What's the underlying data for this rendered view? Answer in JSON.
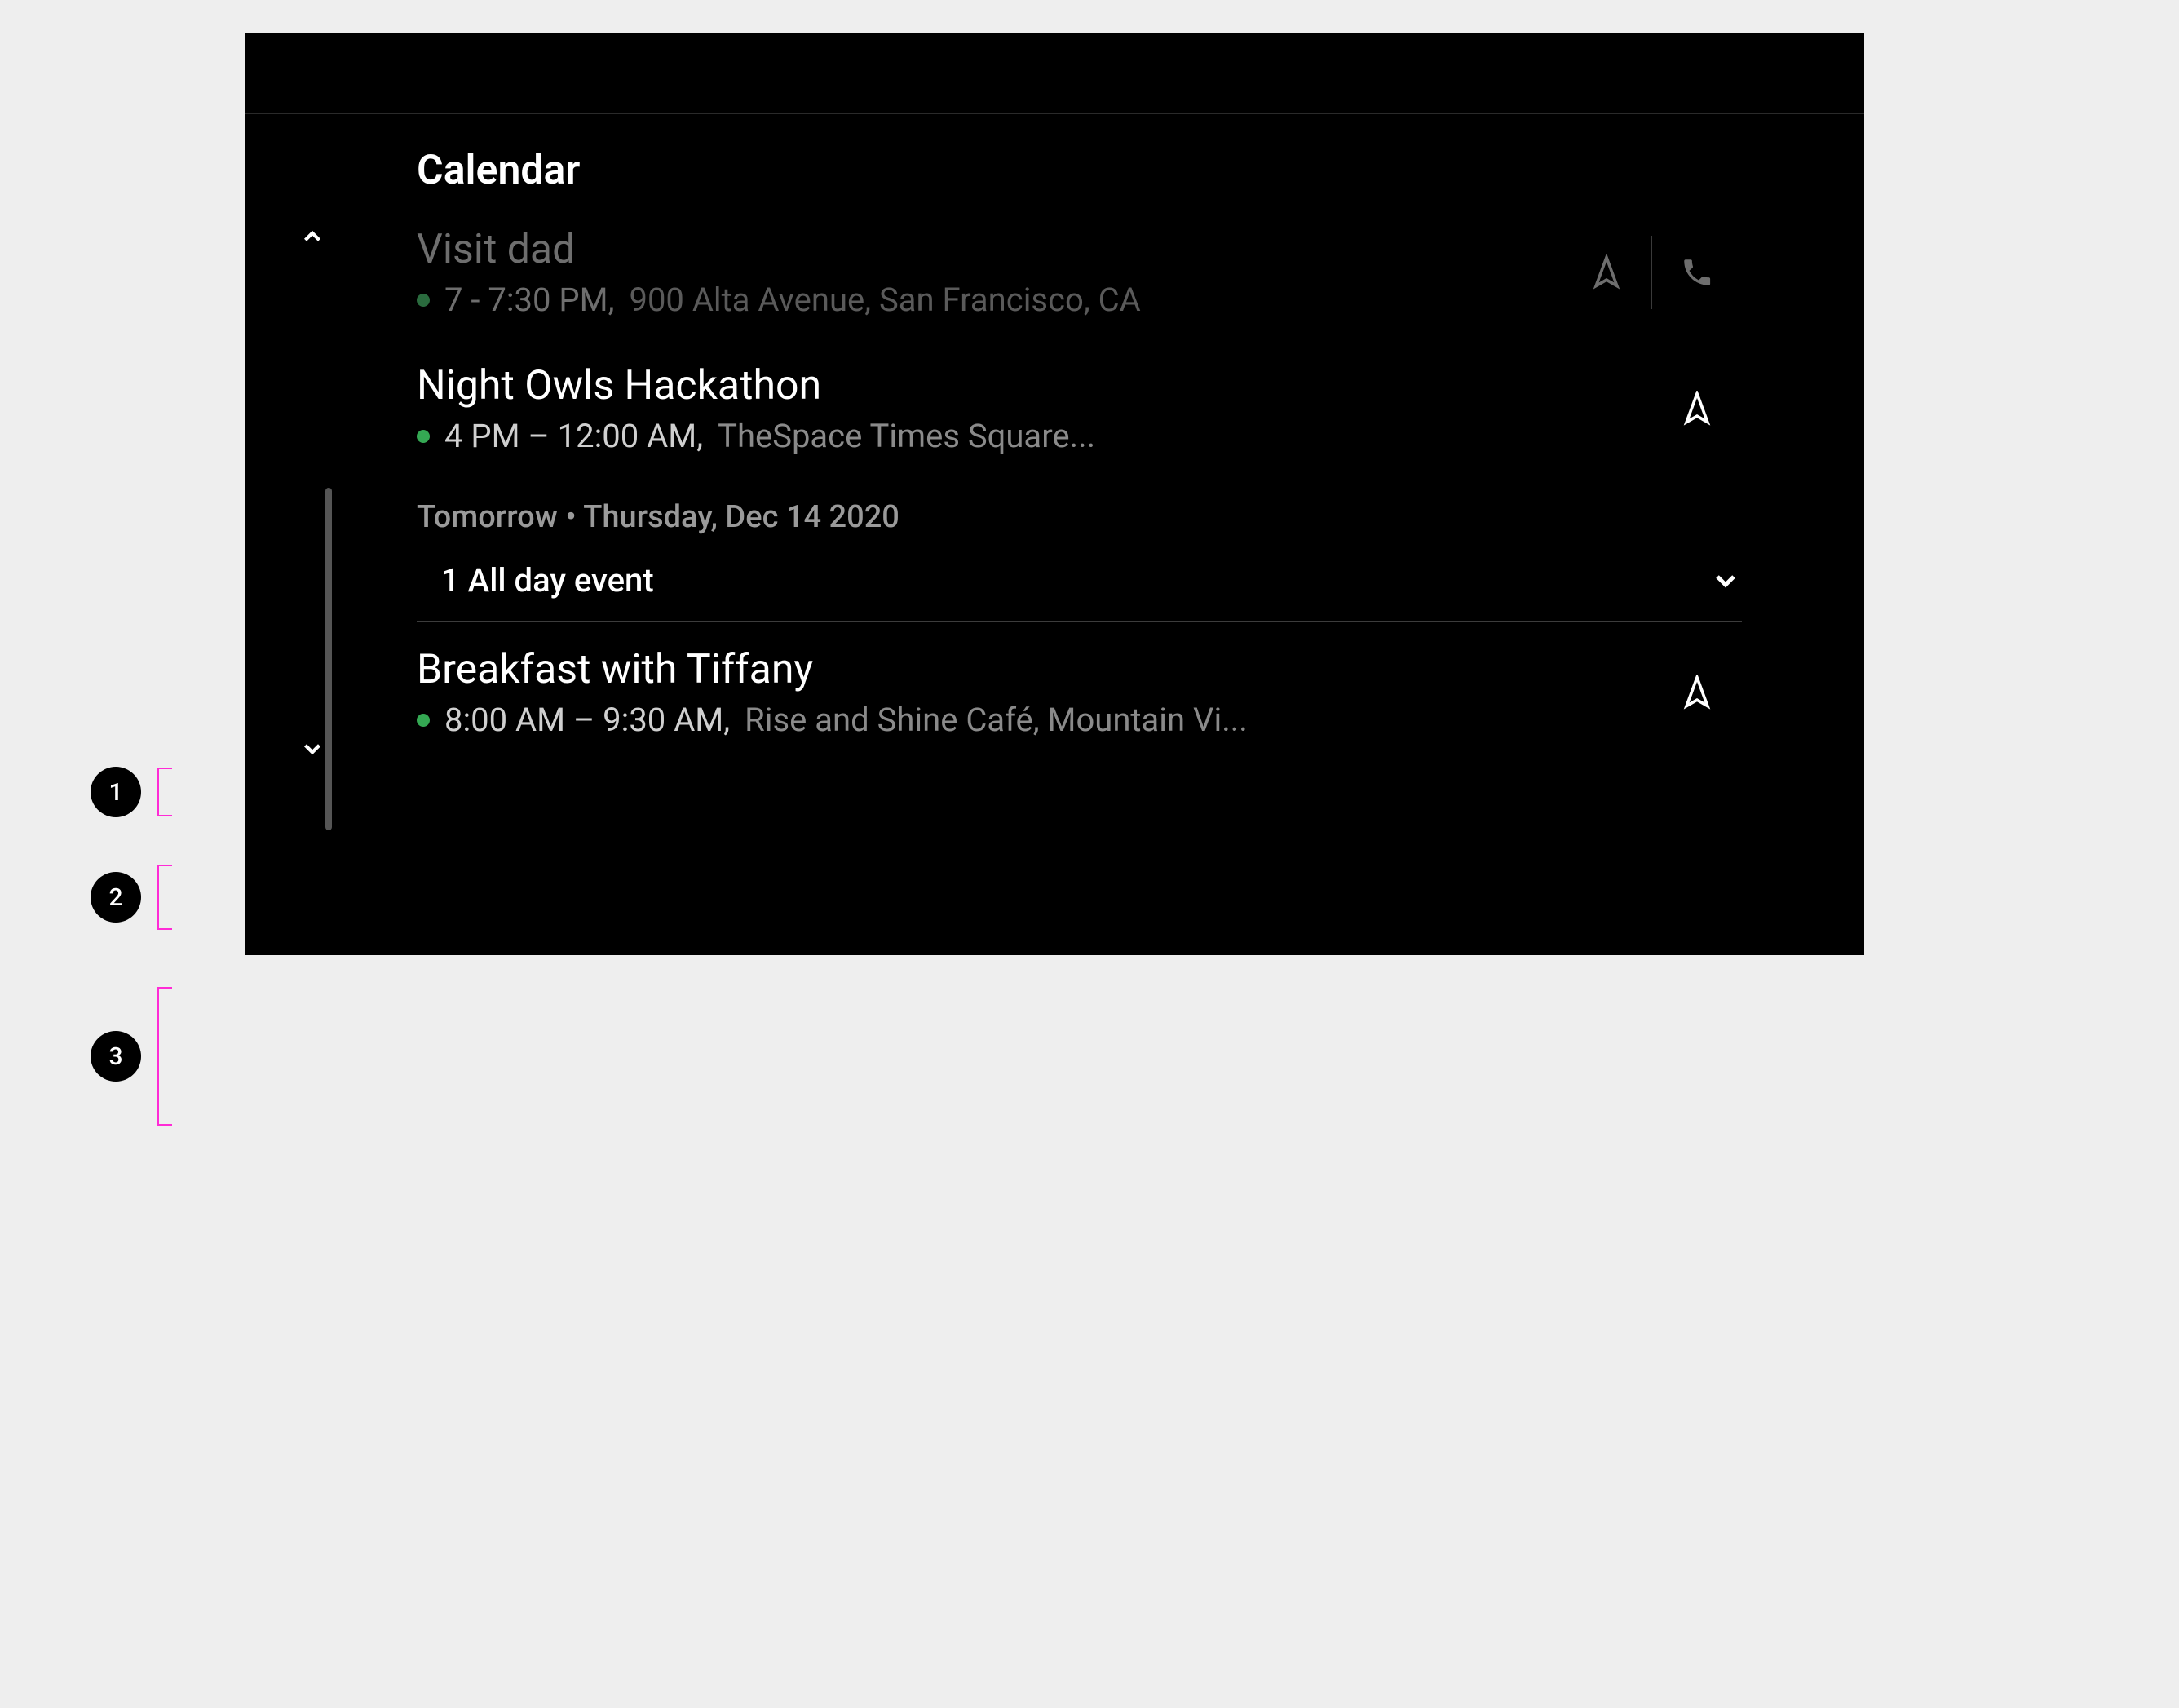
{
  "colors": {
    "status_dot": "#34a853",
    "annotation": "#ff2bd6"
  },
  "header": {
    "title": "Calendar"
  },
  "date_section": {
    "label": "Tomorrow • Thursday, Dec 14 2020"
  },
  "allday": {
    "label": "1 All day event"
  },
  "events": [
    {
      "id": "visit-dad",
      "title": "Visit dad",
      "time": "7 - 7:30 PM,",
      "location": "900 Alta Avenue, San Francisco, CA",
      "dimmed": true,
      "has_call": true
    },
    {
      "id": "hackathon",
      "title": "Night Owls Hackathon",
      "time": "4 PM – 12:00 AM,",
      "location": "TheSpace Times Square...",
      "dimmed": false,
      "has_call": false
    },
    {
      "id": "breakfast",
      "title": "Breakfast with Tiffany",
      "time": "8:00 AM – 9:30 AM,",
      "location": "Rise and Shine Café, Mountain Vi...",
      "dimmed": false,
      "has_call": false
    }
  ],
  "annotations": [
    {
      "n": "1"
    },
    {
      "n": "2"
    },
    {
      "n": "3"
    }
  ]
}
